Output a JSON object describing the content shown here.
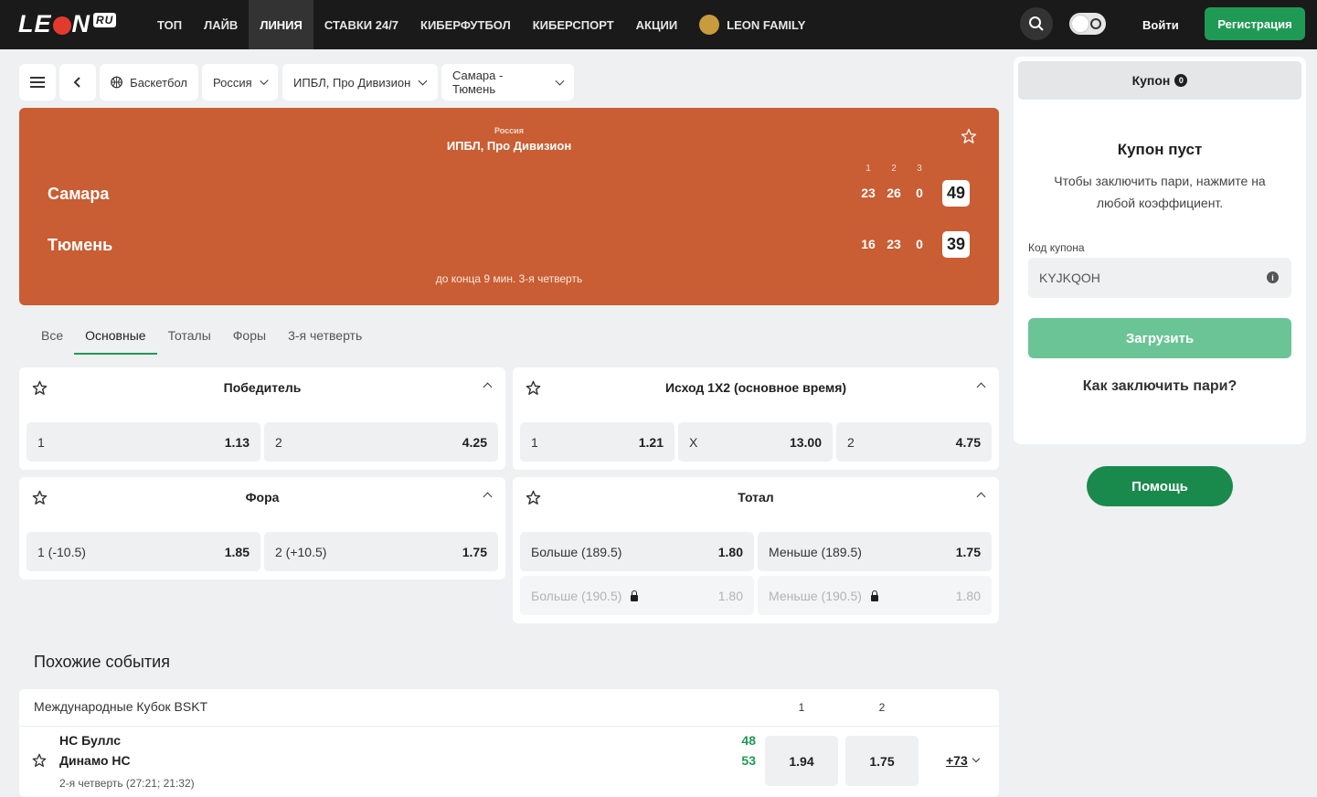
{
  "header": {
    "logo": "LE",
    "logo_tail": "N",
    "logo_ru": "RU",
    "nav": [
      "ТОП",
      "ЛАЙВ",
      "ЛИНИЯ",
      "СТАВКИ 24/7",
      "КИБЕРФУТБОЛ",
      "КИБЕРСПОРТ",
      "АКЦИИ",
      "LEON FAMILY"
    ],
    "active_nav": "ЛИНИЯ",
    "login": "Войти",
    "register": "Регистрация"
  },
  "breadcrumbs": {
    "sport": "Баскетбол",
    "country": "Россия",
    "league": "ИПБЛ, Про Дивизион",
    "match": "Самара - Тюмень"
  },
  "scoreboard": {
    "country": "Россия",
    "league": "ИПБЛ, Про Дивизион",
    "periods": [
      "1",
      "2",
      "3"
    ],
    "home": {
      "name": "Самара",
      "periods": [
        "23",
        "26",
        "0"
      ],
      "total": "49"
    },
    "away": {
      "name": "Тюмень",
      "periods": [
        "16",
        "23",
        "0"
      ],
      "total": "39"
    },
    "status": "до конца 9 мин. 3-я четверть"
  },
  "tabs": [
    "Все",
    "Основные",
    "Тоталы",
    "Форы",
    "3-я четверть"
  ],
  "active_tab": "Основные",
  "markets": {
    "winner": {
      "title": "Победитель",
      "odds": [
        {
          "label": "1",
          "value": "1.13"
        },
        {
          "label": "2",
          "value": "4.25"
        }
      ]
    },
    "x12": {
      "title": "Исход 1X2 (основное время)",
      "odds": [
        {
          "label": "1",
          "value": "1.21"
        },
        {
          "label": "X",
          "value": "13.00"
        },
        {
          "label": "2",
          "value": "4.75"
        }
      ]
    },
    "handicap": {
      "title": "Фора",
      "odds": [
        {
          "label": "1 (-10.5)",
          "value": "1.85"
        },
        {
          "label": "2 (+10.5)",
          "value": "1.75"
        }
      ]
    },
    "total": {
      "title": "Тотал",
      "odds": [
        {
          "label": "Больше (189.5)",
          "value": "1.80"
        },
        {
          "label": "Меньше (189.5)",
          "value": "1.75"
        },
        {
          "label": "Больше (190.5)",
          "value": "1.80"
        },
        {
          "label": "Меньше (190.5)",
          "value": "1.80"
        }
      ]
    }
  },
  "similar": {
    "title": "Похожие события",
    "league": "Международные Кубок BSKT",
    "cols": [
      "1",
      "2"
    ],
    "event": {
      "home": "НС Буллс",
      "away": "Динамо НС",
      "home_score": "48",
      "away_score": "53",
      "status": "2-я четверть (27:21; 21:32)",
      "odd1": "1.94",
      "odd2": "1.75",
      "more": "+73"
    }
  },
  "coupon": {
    "tab": "Купон",
    "count": "0",
    "empty_title": "Купон пуст",
    "empty_text": "Чтобы заключить пари, нажмите на любой коэффициент.",
    "code_label": "Код купона",
    "code_value": "KYJKQOH",
    "load": "Загрузить",
    "how": "Как заключить пари?"
  },
  "help": "Помощь",
  "colors": {
    "accent": "#1f9a55",
    "scoreboard": "#c95d33",
    "header": "#1a1a1a"
  }
}
